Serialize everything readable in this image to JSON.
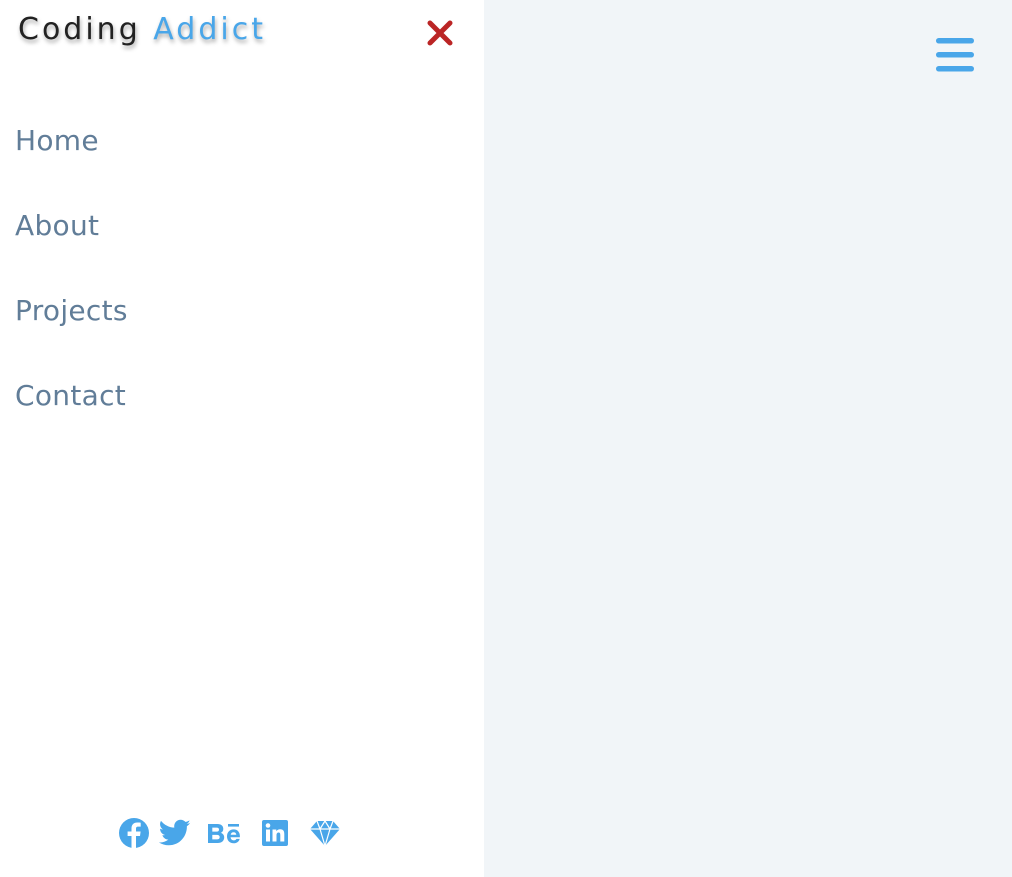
{
  "sidebar": {
    "logo": {
      "part1": "Coding ",
      "part2": "Addict"
    },
    "nav": [
      {
        "label": "Home"
      },
      {
        "label": "About"
      },
      {
        "label": "Projects"
      },
      {
        "label": "Contact"
      }
    ],
    "social_icons": [
      "facebook-icon",
      "twitter-icon",
      "behance-icon",
      "linkedin-icon",
      "sketch-icon"
    ],
    "close_icon": "close-icon"
  },
  "header": {
    "menu_icon": "hamburger-menu-icon"
  },
  "colors": {
    "accent": "#49a6e9",
    "close": "#bb2525",
    "nav_text": "#617d98",
    "logo_dark": "#222222",
    "background": "#f1f5f8",
    "sidebar_bg": "#ffffff"
  }
}
